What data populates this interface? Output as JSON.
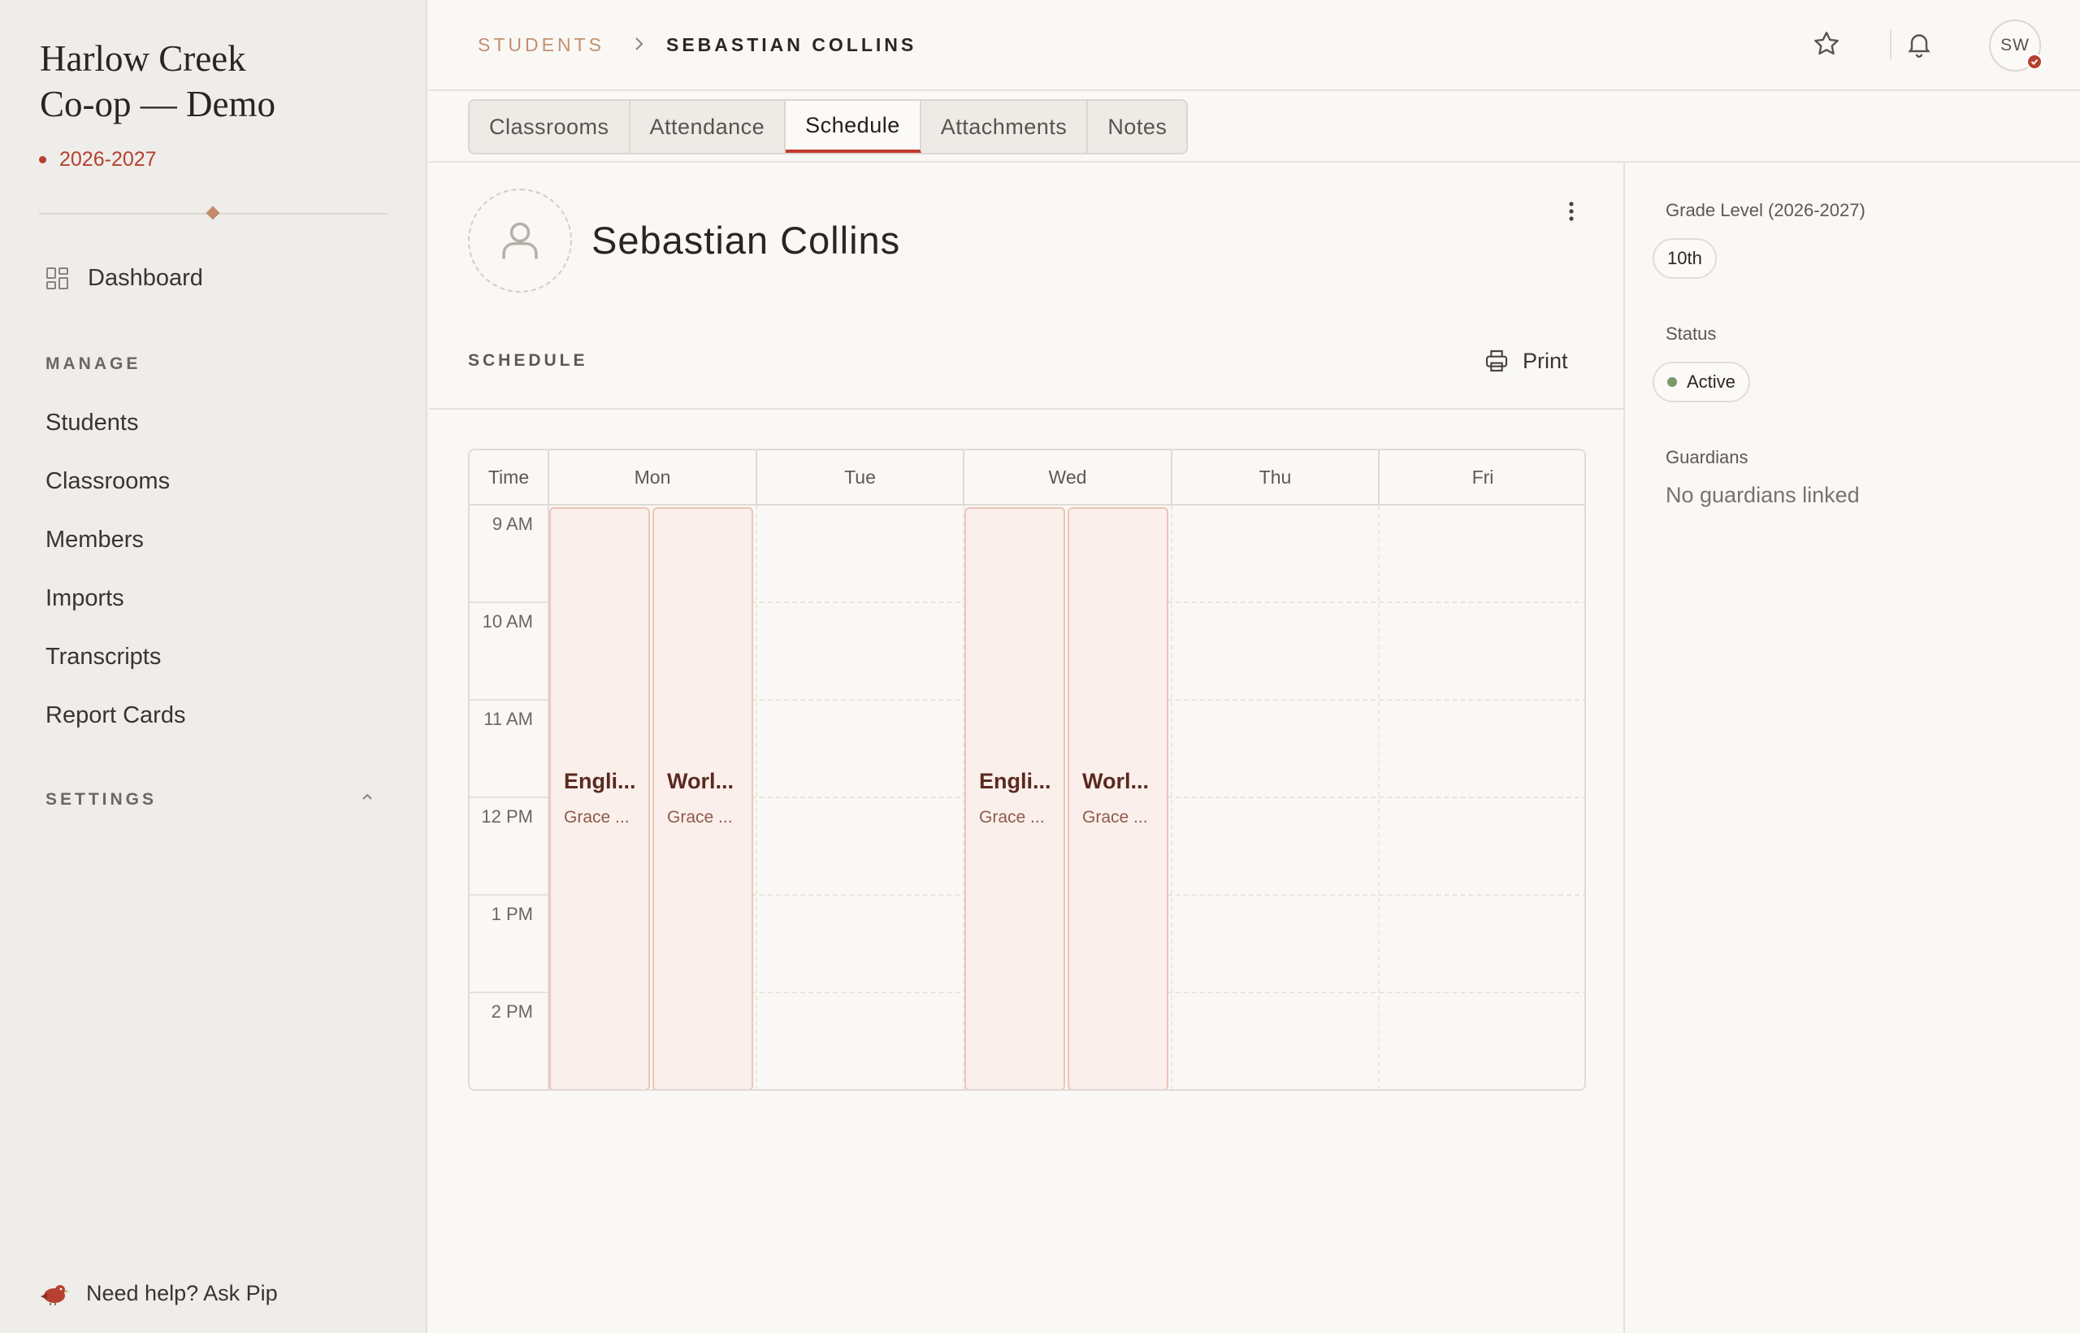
{
  "sidebar": {
    "org_line1": "Harlow Creek",
    "org_line2": "Co-op — Demo",
    "year": "2026-2027",
    "dashboard": "Dashboard",
    "manage_heading": "MANAGE",
    "nav": [
      "Students",
      "Classrooms",
      "Members",
      "Imports",
      "Transcripts",
      "Report Cards"
    ],
    "settings_heading": "SETTINGS",
    "help_text": "Need help? ",
    "help_link": "Ask Pip"
  },
  "header": {
    "breadcrumb_parent": "STUDENTS",
    "breadcrumb_current": "SEBASTIAN COLLINS",
    "avatar_initials": "SW"
  },
  "tabs": [
    "Classrooms",
    "Attendance",
    "Schedule",
    "Attachments",
    "Notes"
  ],
  "active_tab": "Schedule",
  "student": {
    "name": "Sebastian Collins"
  },
  "schedule": {
    "label": "SCHEDULE",
    "print_label": "Print",
    "time_header": "Time",
    "days": [
      "Mon",
      "Tue",
      "Wed",
      "Thu",
      "Fri"
    ],
    "times": [
      "9 AM",
      "10 AM",
      "11 AM",
      "12 PM",
      "1 PM",
      "2 PM"
    ],
    "events": [
      {
        "day": "Mon",
        "title": "Engli...",
        "teacher": "Grace ..."
      },
      {
        "day": "Mon",
        "title": "Worl...",
        "teacher": "Grace ..."
      },
      {
        "day": "Wed",
        "title": "Engli...",
        "teacher": "Grace ..."
      },
      {
        "day": "Wed",
        "title": "Worl...",
        "teacher": "Grace ..."
      }
    ]
  },
  "details": {
    "grade_label": "Grade Level (2026-2027)",
    "grade_value": "10th",
    "status_label": "Status",
    "status_value": "Active",
    "guardians_label": "Guardians",
    "guardians_value": "No guardians linked"
  },
  "colors": {
    "accent": "#b5412f",
    "event_bg": "#fbefeb",
    "status_dot": "#7a9a6a"
  },
  "icons": [
    "dashboard-icon",
    "chevron-right-icon",
    "star-icon",
    "bell-icon",
    "user-icon",
    "kebab-icon",
    "printer-icon",
    "chevron-up-icon",
    "bird-icon"
  ]
}
